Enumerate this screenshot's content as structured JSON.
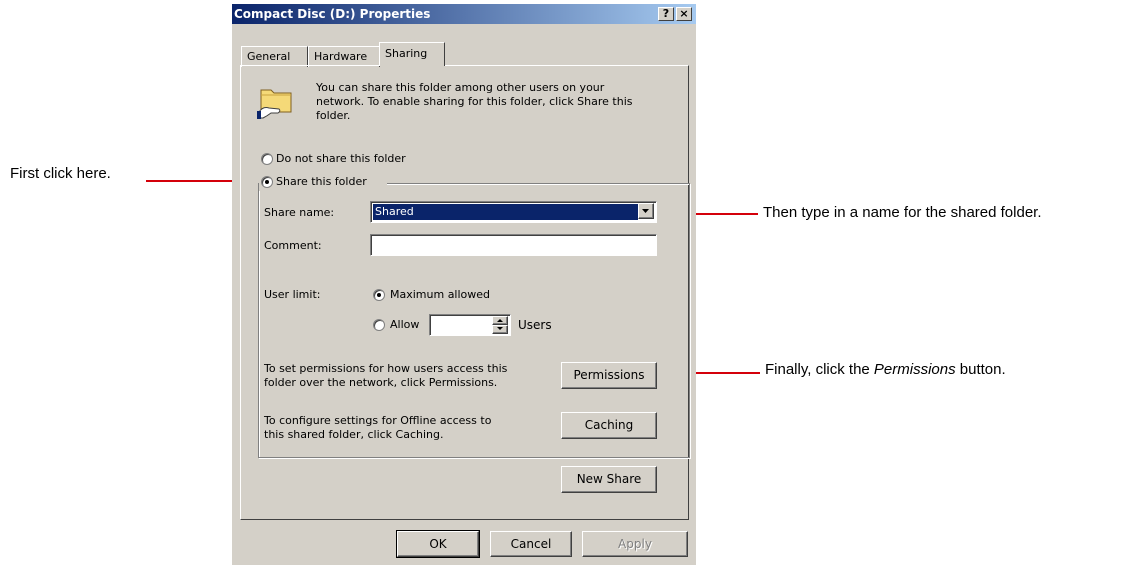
{
  "dialog": {
    "title": "Compact Disc (D:) Properties",
    "help_button": "?",
    "close_button": "×",
    "tabs": [
      {
        "label": "General",
        "active": false
      },
      {
        "label": "Hardware",
        "active": false
      },
      {
        "label": "Sharing",
        "active": true
      }
    ],
    "info_lines": [
      "You can share this folder among other users on your",
      "network.  To enable sharing for this folder, click Share this",
      "folder."
    ],
    "radio_no_share": "Do not share this folder",
    "radio_share": "Share this folder",
    "share_name_label": "Share name:",
    "share_name_value": "Shared",
    "comment_label": "Comment:",
    "comment_value": "",
    "user_limit_label": "User limit:",
    "radio_max_allowed": "Maximum allowed",
    "radio_allow": "Allow",
    "allow_value": "",
    "users_label": "Users",
    "permissions_text": [
      "To set permissions for how users access this",
      "folder over the network, click Permissions."
    ],
    "permissions_button": "Permissions",
    "caching_text": [
      "To configure settings for Offline access to",
      "this shared folder, click Caching."
    ],
    "caching_button": "Caching",
    "new_share_button": "New Share",
    "ok_button": "OK",
    "cancel_button": "Cancel",
    "apply_button": "Apply"
  },
  "callouts": {
    "first": "First click here.",
    "then": "Then type in a name for the shared folder.",
    "finally_prefix": "Finally, click the ",
    "finally_italic": "Permissions",
    "finally_suffix": " button."
  },
  "colors": {
    "dialog_face": "#d4d0c8",
    "title_gradient_start": "#0a246a",
    "title_gradient_end": "#a6caf0",
    "selection": "#0a246a",
    "callout_line": "#d4000a"
  }
}
